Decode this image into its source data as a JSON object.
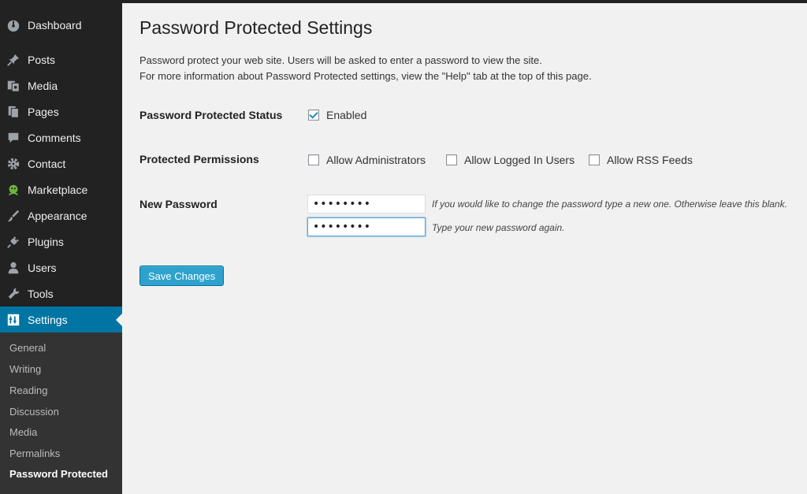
{
  "sidebar": {
    "items": [
      {
        "label": "Dashboard",
        "icon": "dashboard-icon"
      },
      {
        "label": "Posts",
        "icon": "pin-icon"
      },
      {
        "label": "Media",
        "icon": "media-icon"
      },
      {
        "label": "Pages",
        "icon": "pages-icon"
      },
      {
        "label": "Comments",
        "icon": "comment-icon"
      },
      {
        "label": "Contact",
        "icon": "gear-icon"
      },
      {
        "label": "Marketplace",
        "icon": "marketplace-icon"
      },
      {
        "label": "Appearance",
        "icon": "brush-icon"
      },
      {
        "label": "Plugins",
        "icon": "plug-icon"
      },
      {
        "label": "Users",
        "icon": "user-icon"
      },
      {
        "label": "Tools",
        "icon": "wrench-icon"
      },
      {
        "label": "Settings",
        "icon": "settings-icon",
        "active": true
      }
    ],
    "submenu": [
      "General",
      "Writing",
      "Reading",
      "Discussion",
      "Media",
      "Permalinks",
      "Password Protected"
    ],
    "current_submenu": "Password Protected"
  },
  "page": {
    "title": "Password Protected Settings",
    "desc1": "Password protect your web site. Users will be asked to enter a password to view the site.",
    "desc2": "For more information about Password Protected settings, view the \"Help\" tab at the top of this page."
  },
  "form": {
    "status": {
      "label": "Password Protected Status",
      "option": "Enabled",
      "checked": true
    },
    "permissions": {
      "label": "Protected Permissions",
      "options": [
        {
          "label": "Allow Administrators",
          "checked": false
        },
        {
          "label": "Allow Logged In Users",
          "checked": false
        },
        {
          "label": "Allow RSS Feeds",
          "checked": false
        }
      ]
    },
    "new_password": {
      "label": "New Password",
      "value1": "••••••••",
      "hint1": "If you would like to change the password type a new one. Otherwise leave this blank.",
      "value2": "••••••••",
      "hint2": "Type your new password again."
    },
    "save_label": "Save Changes"
  },
  "colors": {
    "sidebar_bg": "#222222",
    "active": "#0074a2",
    "button": "#2ea2cc"
  }
}
